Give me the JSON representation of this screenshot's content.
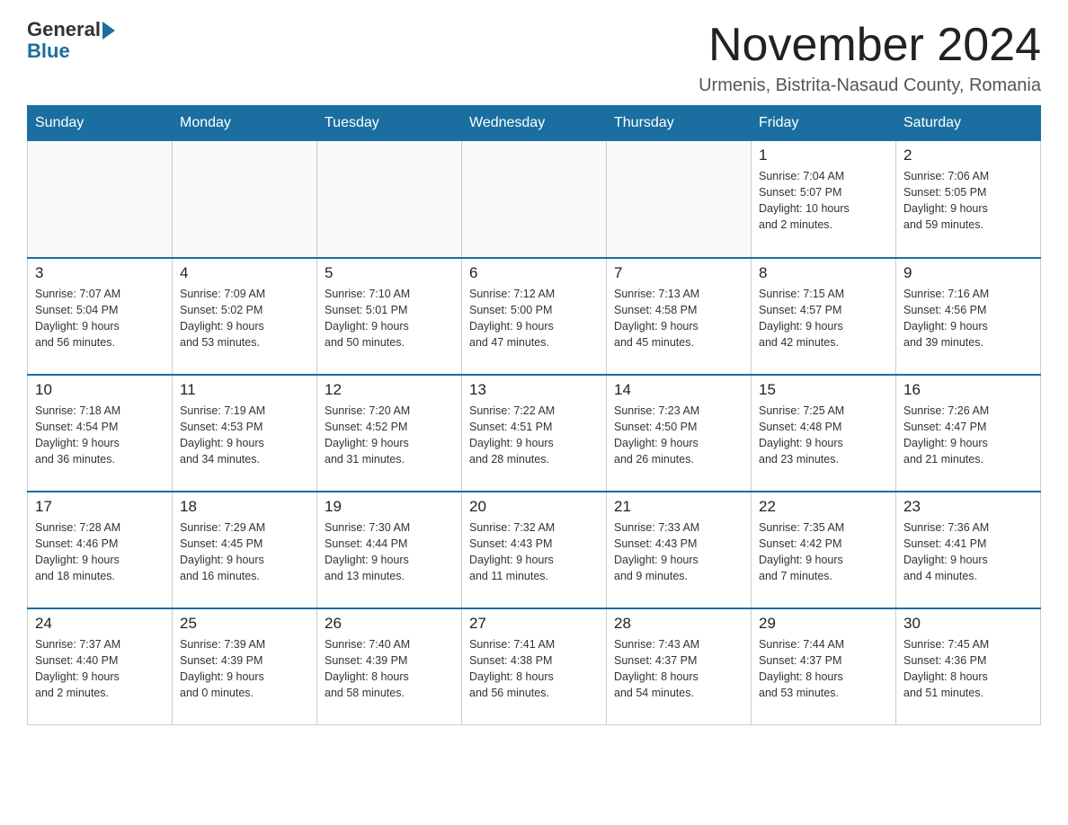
{
  "header": {
    "logo_general": "General",
    "logo_blue": "Blue",
    "month_title": "November 2024",
    "subtitle": "Urmenis, Bistrita-Nasaud County, Romania"
  },
  "days_of_week": [
    "Sunday",
    "Monday",
    "Tuesday",
    "Wednesday",
    "Thursday",
    "Friday",
    "Saturday"
  ],
  "weeks": [
    [
      {
        "day": "",
        "info": ""
      },
      {
        "day": "",
        "info": ""
      },
      {
        "day": "",
        "info": ""
      },
      {
        "day": "",
        "info": ""
      },
      {
        "day": "",
        "info": ""
      },
      {
        "day": "1",
        "info": "Sunrise: 7:04 AM\nSunset: 5:07 PM\nDaylight: 10 hours\nand 2 minutes."
      },
      {
        "day": "2",
        "info": "Sunrise: 7:06 AM\nSunset: 5:05 PM\nDaylight: 9 hours\nand 59 minutes."
      }
    ],
    [
      {
        "day": "3",
        "info": "Sunrise: 7:07 AM\nSunset: 5:04 PM\nDaylight: 9 hours\nand 56 minutes."
      },
      {
        "day": "4",
        "info": "Sunrise: 7:09 AM\nSunset: 5:02 PM\nDaylight: 9 hours\nand 53 minutes."
      },
      {
        "day": "5",
        "info": "Sunrise: 7:10 AM\nSunset: 5:01 PM\nDaylight: 9 hours\nand 50 minutes."
      },
      {
        "day": "6",
        "info": "Sunrise: 7:12 AM\nSunset: 5:00 PM\nDaylight: 9 hours\nand 47 minutes."
      },
      {
        "day": "7",
        "info": "Sunrise: 7:13 AM\nSunset: 4:58 PM\nDaylight: 9 hours\nand 45 minutes."
      },
      {
        "day": "8",
        "info": "Sunrise: 7:15 AM\nSunset: 4:57 PM\nDaylight: 9 hours\nand 42 minutes."
      },
      {
        "day": "9",
        "info": "Sunrise: 7:16 AM\nSunset: 4:56 PM\nDaylight: 9 hours\nand 39 minutes."
      }
    ],
    [
      {
        "day": "10",
        "info": "Sunrise: 7:18 AM\nSunset: 4:54 PM\nDaylight: 9 hours\nand 36 minutes."
      },
      {
        "day": "11",
        "info": "Sunrise: 7:19 AM\nSunset: 4:53 PM\nDaylight: 9 hours\nand 34 minutes."
      },
      {
        "day": "12",
        "info": "Sunrise: 7:20 AM\nSunset: 4:52 PM\nDaylight: 9 hours\nand 31 minutes."
      },
      {
        "day": "13",
        "info": "Sunrise: 7:22 AM\nSunset: 4:51 PM\nDaylight: 9 hours\nand 28 minutes."
      },
      {
        "day": "14",
        "info": "Sunrise: 7:23 AM\nSunset: 4:50 PM\nDaylight: 9 hours\nand 26 minutes."
      },
      {
        "day": "15",
        "info": "Sunrise: 7:25 AM\nSunset: 4:48 PM\nDaylight: 9 hours\nand 23 minutes."
      },
      {
        "day": "16",
        "info": "Sunrise: 7:26 AM\nSunset: 4:47 PM\nDaylight: 9 hours\nand 21 minutes."
      }
    ],
    [
      {
        "day": "17",
        "info": "Sunrise: 7:28 AM\nSunset: 4:46 PM\nDaylight: 9 hours\nand 18 minutes."
      },
      {
        "day": "18",
        "info": "Sunrise: 7:29 AM\nSunset: 4:45 PM\nDaylight: 9 hours\nand 16 minutes."
      },
      {
        "day": "19",
        "info": "Sunrise: 7:30 AM\nSunset: 4:44 PM\nDaylight: 9 hours\nand 13 minutes."
      },
      {
        "day": "20",
        "info": "Sunrise: 7:32 AM\nSunset: 4:43 PM\nDaylight: 9 hours\nand 11 minutes."
      },
      {
        "day": "21",
        "info": "Sunrise: 7:33 AM\nSunset: 4:43 PM\nDaylight: 9 hours\nand 9 minutes."
      },
      {
        "day": "22",
        "info": "Sunrise: 7:35 AM\nSunset: 4:42 PM\nDaylight: 9 hours\nand 7 minutes."
      },
      {
        "day": "23",
        "info": "Sunrise: 7:36 AM\nSunset: 4:41 PM\nDaylight: 9 hours\nand 4 minutes."
      }
    ],
    [
      {
        "day": "24",
        "info": "Sunrise: 7:37 AM\nSunset: 4:40 PM\nDaylight: 9 hours\nand 2 minutes."
      },
      {
        "day": "25",
        "info": "Sunrise: 7:39 AM\nSunset: 4:39 PM\nDaylight: 9 hours\nand 0 minutes."
      },
      {
        "day": "26",
        "info": "Sunrise: 7:40 AM\nSunset: 4:39 PM\nDaylight: 8 hours\nand 58 minutes."
      },
      {
        "day": "27",
        "info": "Sunrise: 7:41 AM\nSunset: 4:38 PM\nDaylight: 8 hours\nand 56 minutes."
      },
      {
        "day": "28",
        "info": "Sunrise: 7:43 AM\nSunset: 4:37 PM\nDaylight: 8 hours\nand 54 minutes."
      },
      {
        "day": "29",
        "info": "Sunrise: 7:44 AM\nSunset: 4:37 PM\nDaylight: 8 hours\nand 53 minutes."
      },
      {
        "day": "30",
        "info": "Sunrise: 7:45 AM\nSunset: 4:36 PM\nDaylight: 8 hours\nand 51 minutes."
      }
    ]
  ]
}
